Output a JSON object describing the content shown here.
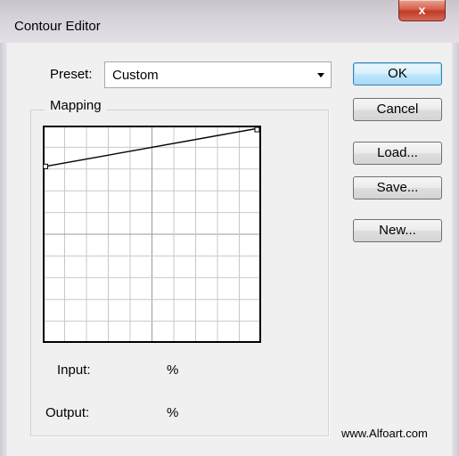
{
  "window": {
    "title": "Contour Editor",
    "close_glyph": "x"
  },
  "preset": {
    "label": "Preset:",
    "value": "Custom",
    "arrow": "dropdown-arrow"
  },
  "mapping": {
    "title": "Mapping",
    "curve_points": [
      {
        "input": 0,
        "output": 82
      },
      {
        "input": 100,
        "output": 100
      }
    ],
    "input_label": "Input:",
    "input_unit": "%",
    "output_label": "Output:",
    "output_unit": "%"
  },
  "buttons": {
    "ok": "OK",
    "cancel": "Cancel",
    "load": "Load...",
    "save": "Save...",
    "new": "New..."
  },
  "watermark": "www.Alfoart.com",
  "colors": {
    "close_red": "#c9432e",
    "ok_blue": "#3c7fb1",
    "grid": "#c8c8c8"
  }
}
